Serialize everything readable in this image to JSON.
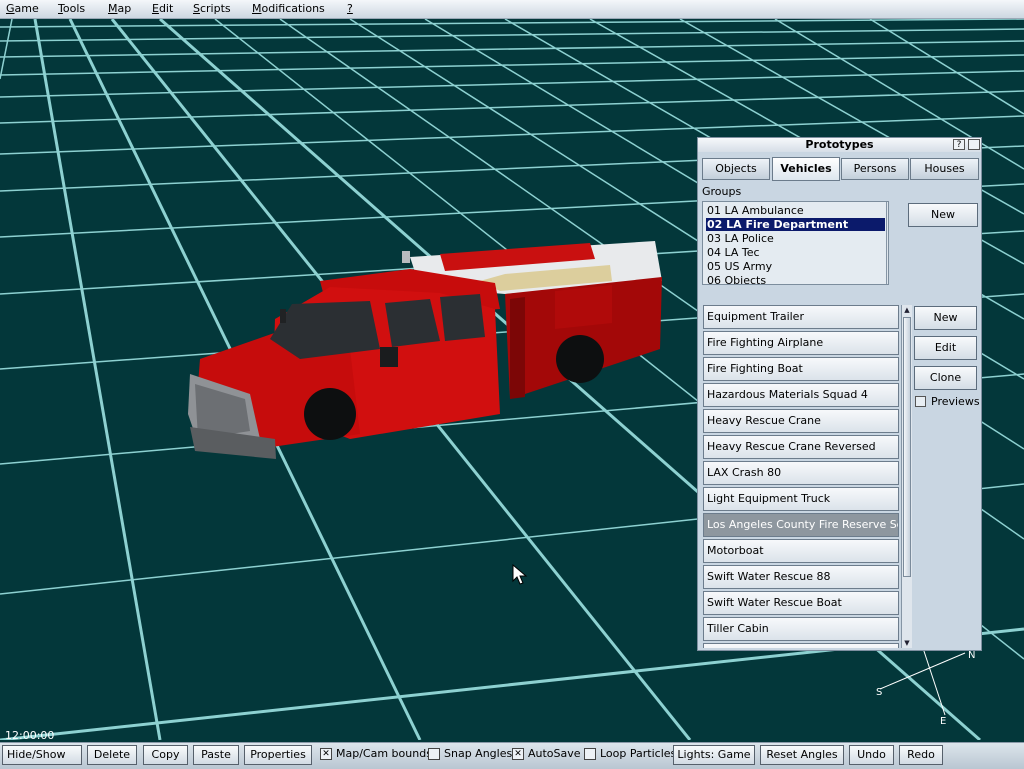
{
  "menu": {
    "items": [
      {
        "mnem": "G",
        "rest": "ame"
      },
      {
        "mnem": "T",
        "rest": "ools"
      },
      {
        "mnem": "M",
        "rest": "ap"
      },
      {
        "mnem": "E",
        "rest": "dit"
      },
      {
        "mnem": "S",
        "rest": "cripts"
      },
      {
        "mnem": "M",
        "rest": "odifications"
      },
      {
        "mnem": "?",
        "rest": ""
      }
    ]
  },
  "viewport": {
    "clock": "12:00:00",
    "compass": {
      "n": "N",
      "s": "S",
      "e": "E"
    },
    "colors": {
      "ground": "#03373a",
      "grid": "#a6ecec",
      "vehicle": "#d40c0c"
    }
  },
  "prototypes": {
    "title": "Prototypes",
    "help_btn": "?",
    "tabs": [
      "Objects",
      "Vehicles",
      "Persons",
      "Houses"
    ],
    "active_tab": "Vehicles",
    "groups_label": "Groups",
    "groups": [
      "01 LA Ambulance",
      "02 LA Fire Department",
      "03 LA Police",
      "04 LA Tec",
      "05 US Army",
      "06 Objects"
    ],
    "selected_group": "02 LA Fire Department",
    "groups_new": "New",
    "vehicles": [
      "Equipment Trailer",
      "Fire Fighting Airplane",
      "Fire Fighting Boat",
      "Hazardous Materials Squad 4",
      "Heavy Rescue Crane",
      "Heavy Rescue Crane Reversed",
      "LAX Crash 80",
      "Light Equipment Truck",
      "Los Angeles County Fire Reserve Squad",
      "Motorboat",
      "Swift Water Rescue 88",
      "Swift Water Rescue Boat",
      "Tiller Cabin"
    ],
    "selected_vehicle": "Los Angeles County Fire Reserve Squad",
    "buttons": {
      "new": "New",
      "edit": "Edit",
      "clone": "Clone"
    },
    "previews_label": "Previews",
    "previews_checked": false
  },
  "toolbar": {
    "hide_show": "Hide/Show",
    "delete": "Delete",
    "copy": "Copy",
    "paste": "Paste",
    "properties": "Properties",
    "map_cam_bounds": "Map/Cam bounds",
    "map_cam_bounds_checked": true,
    "snap_angles": "Snap Angles",
    "snap_angles_checked": false,
    "autosave": "AutoSave",
    "autosave_checked": true,
    "loop_particles": "Loop Particles",
    "loop_particles_checked": false,
    "lights": "Lights: Game",
    "reset_angles": "Reset Angles",
    "undo": "Undo",
    "redo": "Redo"
  }
}
